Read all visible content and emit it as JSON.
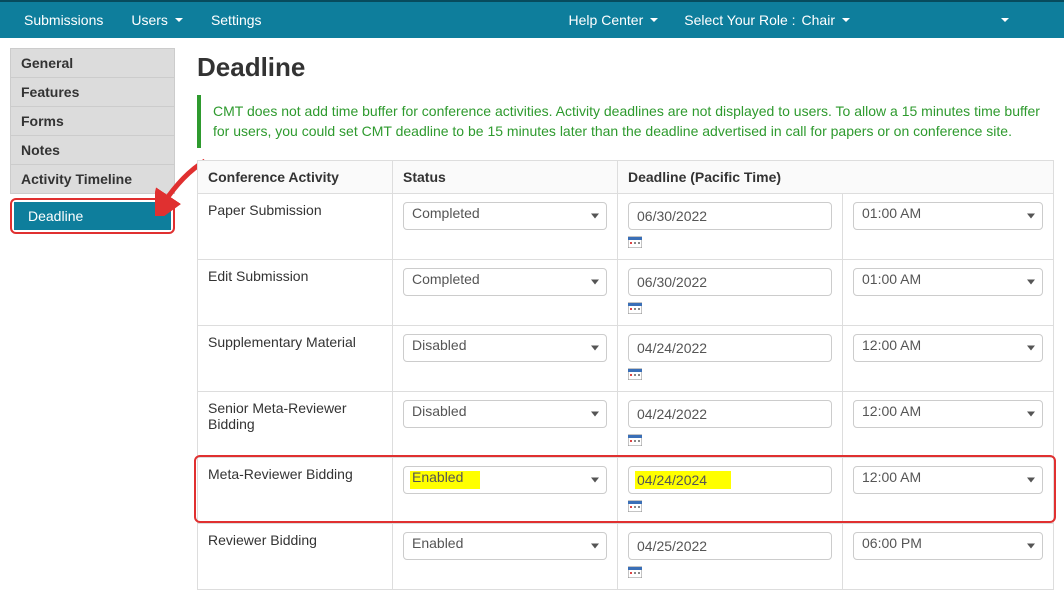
{
  "topnav": {
    "submissions": "Submissions",
    "users": "Users",
    "settings": "Settings",
    "help": "Help Center",
    "role_label": "Select Your Role :",
    "role_value": "Chair"
  },
  "sidebar": {
    "items": [
      "General",
      "Features",
      "Forms",
      "Notes",
      "Activity Timeline"
    ],
    "active": "Deadline"
  },
  "page": {
    "title": "Deadline",
    "info": "CMT does not add time buffer for conference activities. Activity deadlines are not displayed to users. To allow a 15 minutes time buffer for users, you could set CMT deadline to be 15 minutes later than the deadline advertised in call for papers or on conference site."
  },
  "table": {
    "headers": {
      "activity": "Conference Activity",
      "status": "Status",
      "deadline": "Deadline (Pacific Time)"
    },
    "rows": [
      {
        "activity": "Paper Submission",
        "status": "Completed",
        "date": "06/30/2022",
        "time": "01:00 AM",
        "hl": false
      },
      {
        "activity": "Edit Submission",
        "status": "Completed",
        "date": "06/30/2022",
        "time": "01:00 AM",
        "hl": false
      },
      {
        "activity": "Supplementary Material",
        "status": "Disabled",
        "date": "04/24/2022",
        "time": "12:00 AM",
        "hl": false
      },
      {
        "activity": "Senior Meta-Reviewer Bidding",
        "status": "Disabled",
        "date": "04/24/2022",
        "time": "12:00 AM",
        "hl": false
      },
      {
        "activity": "Meta-Reviewer Bidding",
        "status": "Enabled",
        "date": "04/24/2024",
        "time": "12:00 AM",
        "hl": true
      },
      {
        "activity": "Reviewer Bidding",
        "status": "Enabled",
        "date": "04/25/2022",
        "time": "06:00 PM",
        "hl": false
      }
    ]
  }
}
